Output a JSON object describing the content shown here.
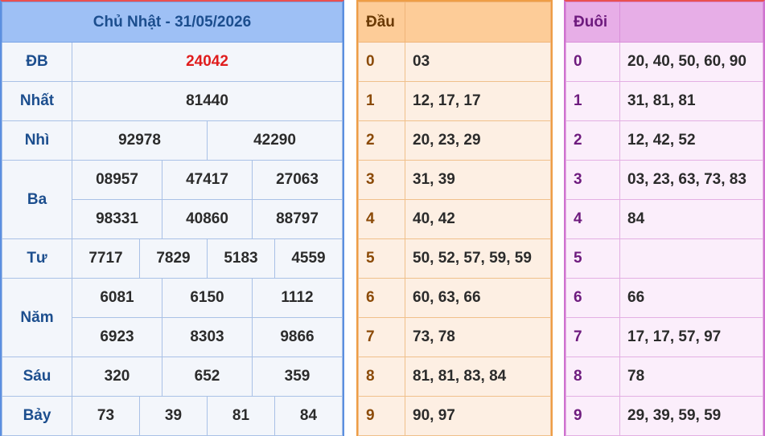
{
  "results": {
    "title": "Chủ Nhật - 31/05/2026",
    "prizes": {
      "db": {
        "label": "ĐB",
        "values": [
          "24042"
        ]
      },
      "nhat": {
        "label": "Nhất",
        "values": [
          "81440"
        ]
      },
      "nhi": {
        "label": "Nhì",
        "values": [
          "92978",
          "42290"
        ]
      },
      "ba": {
        "label": "Ba",
        "values": [
          "08957",
          "47417",
          "27063",
          "98331",
          "40860",
          "88797"
        ]
      },
      "tu": {
        "label": "Tư",
        "values": [
          "7717",
          "7829",
          "5183",
          "4559"
        ]
      },
      "nam": {
        "label": "Năm",
        "values": [
          "6081",
          "6150",
          "1112",
          "6923",
          "8303",
          "9866"
        ]
      },
      "sau": {
        "label": "Sáu",
        "values": [
          "320",
          "652",
          "359"
        ]
      },
      "bay": {
        "label": "Bảy",
        "values": [
          "73",
          "39",
          "81",
          "84"
        ]
      }
    }
  },
  "dau": {
    "header": "Đầu",
    "rows": [
      {
        "key": "0",
        "values": "03"
      },
      {
        "key": "1",
        "values": "12, 17, 17"
      },
      {
        "key": "2",
        "values": "20, 23, 29"
      },
      {
        "key": "3",
        "values": "31, 39"
      },
      {
        "key": "4",
        "values": "40, 42"
      },
      {
        "key": "5",
        "values": "50, 52, 57, 59, 59"
      },
      {
        "key": "6",
        "values": "60, 63, 66"
      },
      {
        "key": "7",
        "values": "73, 78"
      },
      {
        "key": "8",
        "values": "81, 81, 83, 84"
      },
      {
        "key": "9",
        "values": "90, 97"
      }
    ]
  },
  "duoi": {
    "header": "Đuôi",
    "rows": [
      {
        "key": "0",
        "values": "20, 40, 50, 60, 90"
      },
      {
        "key": "1",
        "values": "31, 81, 81"
      },
      {
        "key": "2",
        "values": "12, 42, 52"
      },
      {
        "key": "3",
        "values": "03, 23, 63, 73, 83"
      },
      {
        "key": "4",
        "values": "84"
      },
      {
        "key": "5",
        "values": ""
      },
      {
        "key": "6",
        "values": "66"
      },
      {
        "key": "7",
        "values": "17, 17, 57, 97"
      },
      {
        "key": "8",
        "values": "78"
      },
      {
        "key": "9",
        "values": "29, 39, 59, 59"
      }
    ]
  },
  "colors": {
    "results_header_bg": "#9ec0f5",
    "special_prize": "#e01d1d",
    "dau_header_bg": "#fdcc98",
    "duoi_header_bg": "#e7aee7"
  }
}
